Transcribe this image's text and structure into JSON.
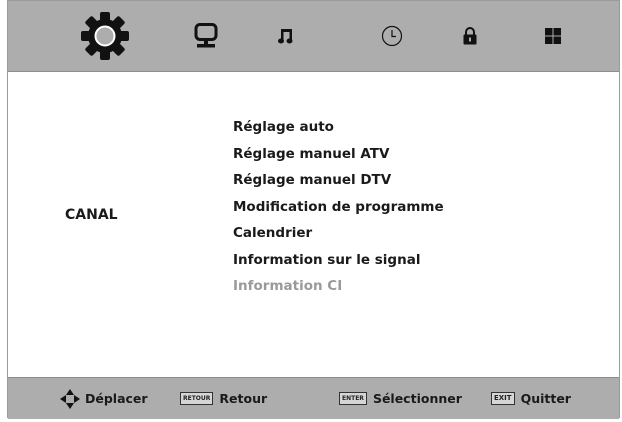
{
  "tabs": [
    {
      "name": "canal",
      "icon": "gear-icon",
      "selected": true
    },
    {
      "name": "image",
      "icon": "monitor-icon",
      "selected": false
    },
    {
      "name": "son",
      "icon": "music-note-icon",
      "selected": false
    },
    {
      "name": "heure",
      "icon": "clock-icon",
      "selected": false
    },
    {
      "name": "verrouillage",
      "icon": "lock-icon",
      "selected": false
    },
    {
      "name": "configuration",
      "icon": "grid-icon",
      "selected": false
    }
  ],
  "category_label": "CANAL",
  "menu": {
    "items": [
      {
        "label": "Réglage auto",
        "enabled": true
      },
      {
        "label": "Réglage manuel ATV",
        "enabled": true
      },
      {
        "label": "Réglage manuel DTV",
        "enabled": true
      },
      {
        "label": "Modification de programme",
        "enabled": true
      },
      {
        "label": "Calendrier",
        "enabled": true
      },
      {
        "label": "Information sur le signal",
        "enabled": true
      },
      {
        "label": "Information CI",
        "enabled": false
      }
    ]
  },
  "footer": {
    "move_label": "Déplacer",
    "back_key": "RETOUR",
    "back_label": "Retour",
    "enter_key": "ENTER",
    "enter_label": "Sélectionner",
    "exit_key": "EXIT",
    "exit_label": "Quitter"
  },
  "colors": {
    "bar": "#adadad",
    "text": "#1a1a1a",
    "disabled": "#9a9a9a"
  }
}
